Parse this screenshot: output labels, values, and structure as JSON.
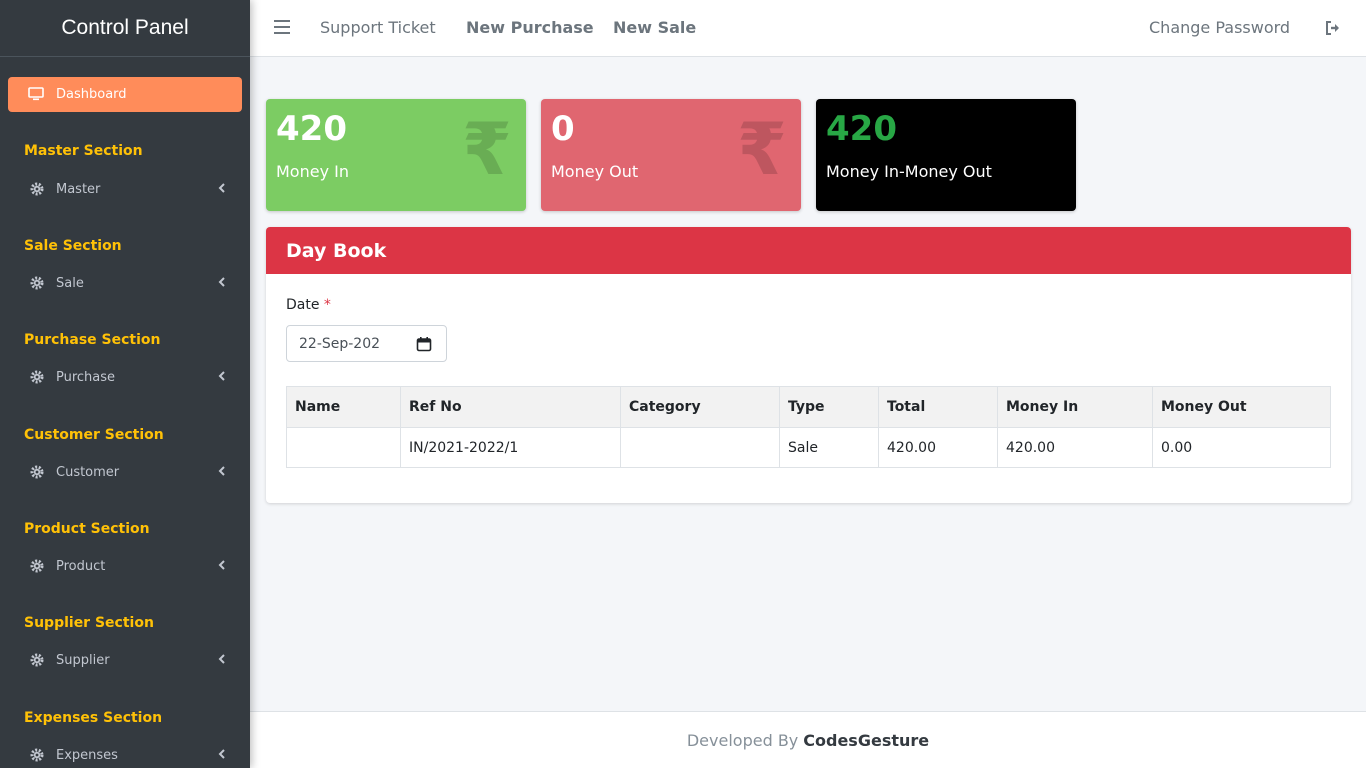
{
  "sidebar": {
    "brand": "Control Panel",
    "dashboard_label": "Dashboard",
    "dashboard_icon": "monitor-icon",
    "sections": [
      {
        "header": "Master Section",
        "item": "Master"
      },
      {
        "header": "Sale Section",
        "item": "Sale"
      },
      {
        "header": "Purchase Section",
        "item": "Purchase"
      },
      {
        "header": "Customer Section",
        "item": "Customer"
      },
      {
        "header": "Product Section",
        "item": "Product"
      },
      {
        "header": "Supplier Section",
        "item": "Supplier"
      },
      {
        "header": "Expenses Section",
        "item": "Expenses"
      }
    ],
    "item_icon": "gear-icon",
    "active_color": "#ff8c5a",
    "section_color": "#ffc107"
  },
  "topnav": {
    "support_ticket": "Support Ticket",
    "new_purchase": "New Purchase",
    "new_sale": "New Sale",
    "change_password": "Change Password",
    "logout_icon": "logout-icon"
  },
  "stats": {
    "money_in": {
      "value": "420",
      "label": "Money In",
      "color": "#7ccc63"
    },
    "money_out": {
      "value": "0",
      "label": "Money Out",
      "color": "#e06670"
    },
    "net": {
      "value": "420",
      "label": "Money In-Money Out",
      "color": "#000000",
      "value_color": "#28a745"
    },
    "currency_symbol": "₹"
  },
  "daybook": {
    "title": "Day Book",
    "header_color": "#dc3545",
    "date_label": "Date",
    "required_mark": "*",
    "date_value": "22-Sep-202",
    "columns": [
      "Name",
      "Ref No",
      "Category",
      "Type",
      "Total",
      "Money In",
      "Money Out"
    ],
    "rows": [
      [
        "",
        "IN/2021-2022/1",
        "",
        "Sale",
        "420.00",
        "420.00",
        "0.00"
      ]
    ]
  },
  "footer": {
    "prefix": "Developed By",
    "company": "CodesGesture"
  }
}
